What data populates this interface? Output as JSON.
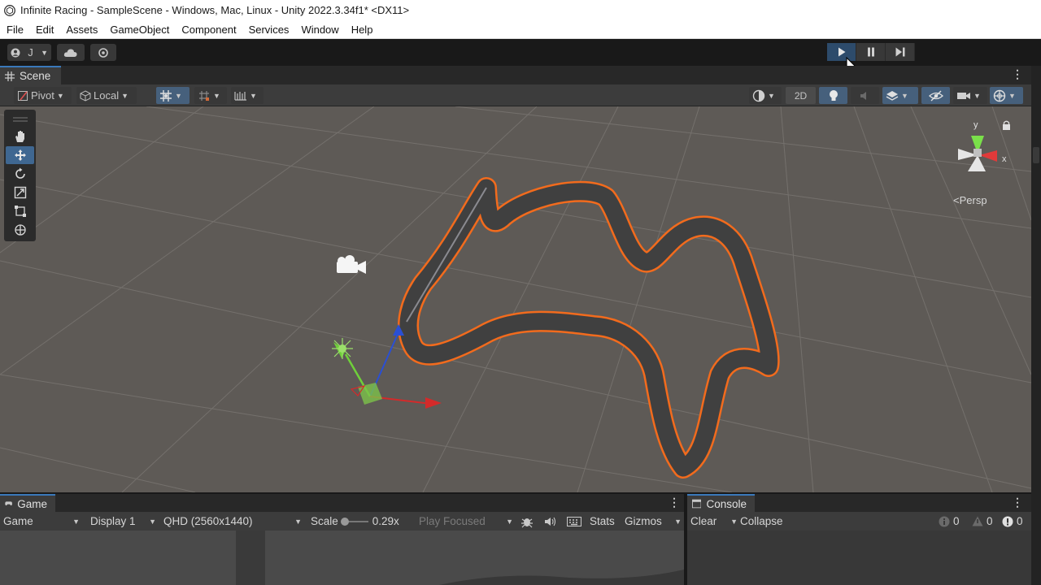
{
  "window": {
    "title": "Infinite Racing - SampleScene - Windows, Mac, Linux - Unity 2022.3.34f1* <DX11>"
  },
  "menu": [
    "File",
    "Edit",
    "Assets",
    "GameObject",
    "Component",
    "Services",
    "Window",
    "Help"
  ],
  "toolbar": {
    "account_initial": "J"
  },
  "scene": {
    "tab_label": "Scene",
    "pivot_label": "Pivot",
    "local_label": "Local",
    "mode_2d": "2D",
    "camera_mode": "Persp",
    "gizmo_axes": {
      "y": "y",
      "x": "x"
    }
  },
  "game": {
    "tab_label": "Game",
    "view_select": "Game",
    "display_select": "Display 1",
    "resolution_select": "QHD (2560x1440)",
    "scale_label": "Scale",
    "scale_value": "0.29x",
    "play_mode_select": "Play Focused",
    "stats_label": "Stats",
    "gizmos_label": "Gizmos"
  },
  "console": {
    "tab_label": "Console",
    "clear_label": "Clear",
    "collapse_label": "Collapse",
    "log_count": "0",
    "warning_count": "0",
    "error_count": "0"
  },
  "colors": {
    "play_active": "#2d4b6b",
    "track_outline": "#f26b1d",
    "track_surface": "#404040",
    "ground": "#5e5a56",
    "axis_x": "#d42a2a",
    "axis_y": "#6fd03a",
    "axis_z": "#2a4fd4"
  }
}
